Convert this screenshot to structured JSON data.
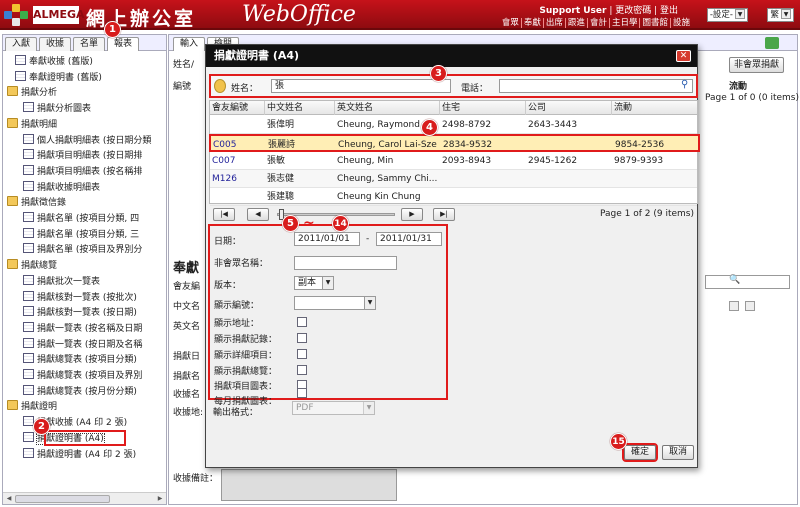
{
  "header": {
    "brand": "ALMEGA",
    "title_cn": "網上辦公室",
    "title_en": "WebOffice",
    "user": "Support User",
    "user_links": "| 更改密碼 | 登出",
    "nav": [
      "會眾",
      "奉獻",
      "出席",
      "跟進",
      "會計",
      "主日學",
      "圖書館",
      "設施"
    ],
    "settings_select": "-設定-",
    "lang_select": "繁"
  },
  "left_tabs": [
    "入獻",
    "收據",
    "名單",
    "報表"
  ],
  "tree": [
    {
      "type": "doc",
      "label": "奉獻收據 (舊版)",
      "indent": 1
    },
    {
      "type": "doc",
      "label": "奉獻證明書 (舊版)",
      "indent": 1
    },
    {
      "type": "folder",
      "label": "捐獻分析",
      "indent": 0
    },
    {
      "type": "doc",
      "label": "捐獻分析圖表",
      "indent": 2
    },
    {
      "type": "folder",
      "label": "捐獻明細",
      "indent": 0
    },
    {
      "type": "doc",
      "label": "個人捐獻明細表 (按日期分類",
      "indent": 2
    },
    {
      "type": "doc",
      "label": "捐獻項目明細表 (按日期排",
      "indent": 2
    },
    {
      "type": "doc",
      "label": "捐獻項目明細表 (按名稱排",
      "indent": 2
    },
    {
      "type": "doc",
      "label": "捐獻收據明細表",
      "indent": 2
    },
    {
      "type": "folder",
      "label": "捐獻徵信錄",
      "indent": 0
    },
    {
      "type": "doc",
      "label": "捐獻名單 (按項目分類, 四",
      "indent": 2
    },
    {
      "type": "doc",
      "label": "捐獻名單 (按項目分類, 三",
      "indent": 2
    },
    {
      "type": "doc",
      "label": "捐獻名單 (按項目及界別分",
      "indent": 2
    },
    {
      "type": "folder",
      "label": "捐獻總覽",
      "indent": 0
    },
    {
      "type": "doc",
      "label": "捐獻批次一覽表",
      "indent": 2
    },
    {
      "type": "doc",
      "label": "捐獻核對一覽表 (按批次)",
      "indent": 2
    },
    {
      "type": "doc",
      "label": "捐獻核對一覽表 (按日期)",
      "indent": 2
    },
    {
      "type": "doc",
      "label": "捐獻一覽表 (按名稱及日期",
      "indent": 2
    },
    {
      "type": "doc",
      "label": "捐獻一覽表 (按日期及名稱",
      "indent": 2
    },
    {
      "type": "doc",
      "label": "捐獻總覽表 (按項目分類)",
      "indent": 2
    },
    {
      "type": "doc",
      "label": "捐獻總覽表 (按項目及界別",
      "indent": 2
    },
    {
      "type": "doc",
      "label": "捐獻總覽表 (按月份分類)",
      "indent": 2
    },
    {
      "type": "folder",
      "label": "捐獻證明",
      "indent": 0
    },
    {
      "type": "doc",
      "label": "捐獻收據 (A4 印 2 張)",
      "indent": 2
    },
    {
      "type": "doc",
      "label": "捐獻證明書 (A4)",
      "indent": 2,
      "selected": true
    },
    {
      "type": "doc",
      "label": "捐獻證明書 (A4 印 2 張)",
      "indent": 2
    }
  ],
  "main_tabs": [
    "輸入",
    "檢閱"
  ],
  "background": {
    "col_name": "姓名/",
    "col_code": "編號",
    "col_mobile": "流動",
    "non_member_button": "非會眾捐獻",
    "section_title": "奉獻",
    "page_info": "Page 1 of 0 (0 items)",
    "labels": [
      "會友編",
      "中文名",
      "英文名",
      "捐獻日",
      "捐獻名",
      "收據名",
      "收據地:"
    ],
    "remark_label": "收據備註："
  },
  "dialog": {
    "title": "捐獻證明書 (A4)",
    "search": {
      "name_label": "姓名：",
      "name_value": "張",
      "phone_label": "電話：",
      "phone_value": ""
    },
    "columns": [
      "會友編號",
      "中文姓名",
      "英文姓名",
      "住宅",
      "公司",
      "流動"
    ],
    "rows": [
      [
        "",
        "張偉明",
        "Cheung, Raymond ...",
        "2498-8792",
        "2643-3443",
        ""
      ],
      [
        "C005",
        "張麗詩",
        "Cheung, Carol Lai-Sze",
        "2834-9532",
        "",
        "9854-2536"
      ],
      [
        "C007",
        "張敏",
        "Cheung, Min",
        "2093-8943",
        "2945-1262",
        "9879-9393"
      ],
      [
        "M126",
        "張志健",
        "Cheung, Sammy Chi...",
        "",
        "",
        ""
      ],
      [
        "",
        "張建聰",
        "Cheung Kin Chung",
        "",
        "",
        ""
      ]
    ],
    "pager": {
      "first": "⏮",
      "prev": "◀",
      "next": "▶",
      "last": "⏭",
      "text": "Page 1 of 2 (9 items)"
    },
    "form": {
      "date_label": "日期：",
      "date_from": "2011/01/01",
      "date_sep": "-",
      "date_to": "2011/01/31",
      "nonmember_label": "非會眾名稱：",
      "version_label": "版本：",
      "version_value": "副本",
      "display_code_label": "顯示編號：",
      "checkboxes": [
        "顯示地址：",
        "顯示捐獻記錄：",
        "顯示詳細項目：",
        "顯示捐獻總覽：",
        "捐獻項目圖表：",
        "每月捐獻圖表："
      ],
      "output_label": "輸出格式：",
      "output_value": "PDF"
    },
    "confirm_button": "確定",
    "cancel_button": "取消"
  },
  "callouts": [
    "1",
    "2",
    "3",
    "4",
    "5",
    "14",
    "15"
  ],
  "colors": {
    "header_red": "#c6121a",
    "callout_red": "#d81c1c",
    "highlight": "#ffeeb5"
  }
}
